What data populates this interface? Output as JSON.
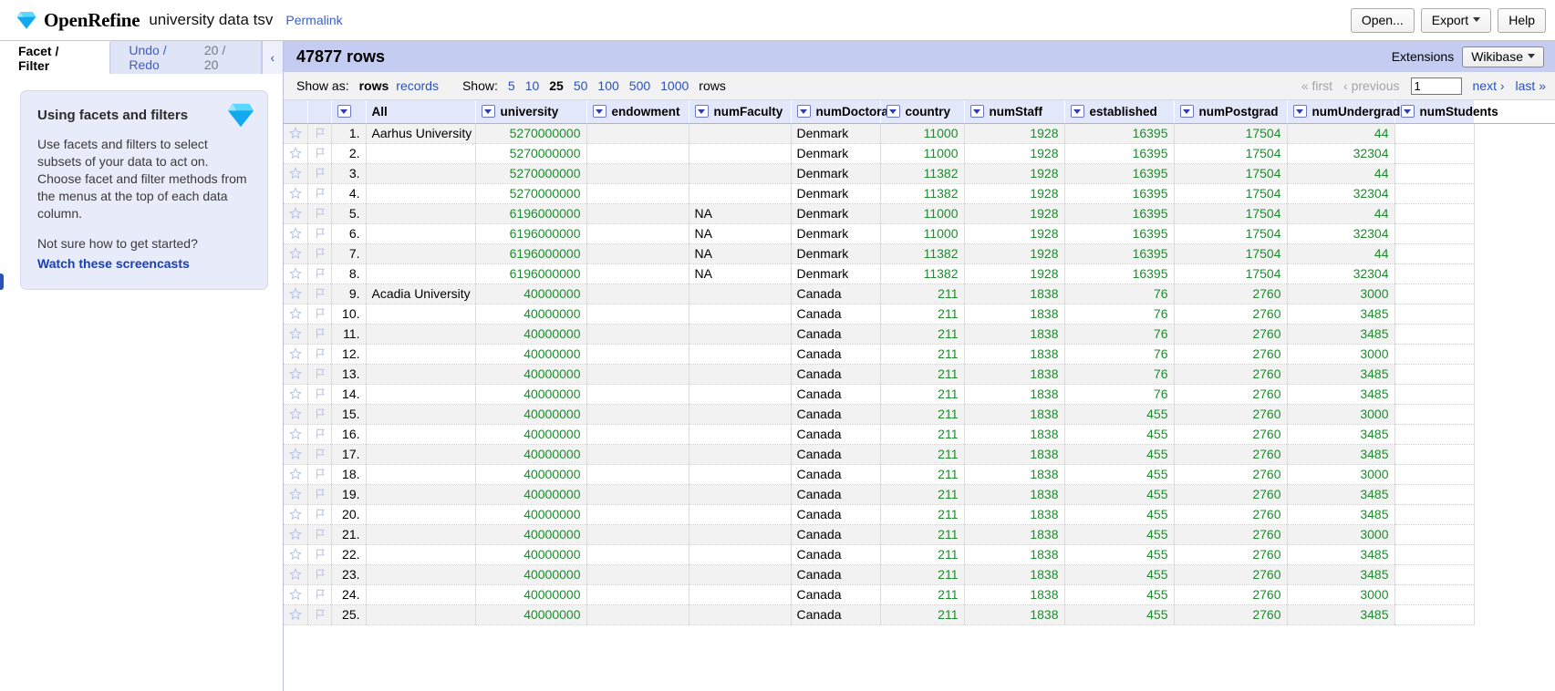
{
  "header": {
    "app_title": "OpenRefine",
    "project_name": "university data tsv",
    "permalink": "Permalink",
    "open_button": "Open...",
    "export_button": "Export",
    "help_button": "Help"
  },
  "left_panel": {
    "tabs": [
      {
        "label": "Facet / Filter",
        "active": true
      },
      {
        "label": "Undo / Redo",
        "count": "20 / 20",
        "active": false
      }
    ],
    "collapse_icon": "‹",
    "help_box": {
      "title": "Using facets and filters",
      "paragraph1": "Use facets and filters to select subsets of your data to act on. Choose facet and filter methods from the menus at the top of each data column.",
      "paragraph2": "Not sure how to get started?",
      "link": "Watch these screencasts"
    }
  },
  "summary_bar": {
    "row_count": "47877 rows",
    "extensions_label": "Extensions",
    "wikibase_button": "Wikibase"
  },
  "controls": {
    "show_as_label": "Show as:",
    "show_as_options": [
      {
        "label": "rows",
        "selected": true
      },
      {
        "label": "records",
        "selected": false
      }
    ],
    "show_label": "Show:",
    "page_sizes": [
      {
        "label": "5",
        "selected": false
      },
      {
        "label": "10",
        "selected": false
      },
      {
        "label": "25",
        "selected": true
      },
      {
        "label": "50",
        "selected": false
      },
      {
        "label": "100",
        "selected": false
      },
      {
        "label": "500",
        "selected": false
      },
      {
        "label": "1000",
        "selected": false
      }
    ],
    "rows_word": "rows",
    "pager": {
      "first": "« first",
      "previous": "‹ previous",
      "page_value": "1",
      "next": "next ›",
      "last": "last »"
    }
  },
  "table": {
    "columns": [
      "All",
      "university",
      "endowment",
      "numFaculty",
      "numDoctoral",
      "country",
      "numStaff",
      "established",
      "numPostgrad",
      "numUndergrad",
      "numStudents"
    ],
    "rows": [
      {
        "index": "1.",
        "university": "Aarhus University",
        "endowment": "5270000000",
        "numFaculty": "",
        "numDoctoral": "",
        "country": "Denmark",
        "numStaff": "11000",
        "established": "1928",
        "numPostgrad": "16395",
        "numUndergrad": "17504",
        "numStudents": "44"
      },
      {
        "index": "2.",
        "university": "",
        "endowment": "5270000000",
        "numFaculty": "",
        "numDoctoral": "",
        "country": "Denmark",
        "numStaff": "11000",
        "established": "1928",
        "numPostgrad": "16395",
        "numUndergrad": "17504",
        "numStudents": "32304"
      },
      {
        "index": "3.",
        "university": "",
        "endowment": "5270000000",
        "numFaculty": "",
        "numDoctoral": "",
        "country": "Denmark",
        "numStaff": "11382",
        "established": "1928",
        "numPostgrad": "16395",
        "numUndergrad": "17504",
        "numStudents": "44"
      },
      {
        "index": "4.",
        "university": "",
        "endowment": "5270000000",
        "numFaculty": "",
        "numDoctoral": "",
        "country": "Denmark",
        "numStaff": "11382",
        "established": "1928",
        "numPostgrad": "16395",
        "numUndergrad": "17504",
        "numStudents": "32304"
      },
      {
        "index": "5.",
        "university": "",
        "endowment": "6196000000",
        "numFaculty": "",
        "numDoctoral": "NA",
        "country": "Denmark",
        "numStaff": "11000",
        "established": "1928",
        "numPostgrad": "16395",
        "numUndergrad": "17504",
        "numStudents": "44"
      },
      {
        "index": "6.",
        "university": "",
        "endowment": "6196000000",
        "numFaculty": "",
        "numDoctoral": "NA",
        "country": "Denmark",
        "numStaff": "11000",
        "established": "1928",
        "numPostgrad": "16395",
        "numUndergrad": "17504",
        "numStudents": "32304"
      },
      {
        "index": "7.",
        "university": "",
        "endowment": "6196000000",
        "numFaculty": "",
        "numDoctoral": "NA",
        "country": "Denmark",
        "numStaff": "11382",
        "established": "1928",
        "numPostgrad": "16395",
        "numUndergrad": "17504",
        "numStudents": "44"
      },
      {
        "index": "8.",
        "university": "",
        "endowment": "6196000000",
        "numFaculty": "",
        "numDoctoral": "NA",
        "country": "Denmark",
        "numStaff": "11382",
        "established": "1928",
        "numPostgrad": "16395",
        "numUndergrad": "17504",
        "numStudents": "32304"
      },
      {
        "index": "9.",
        "university": "Acadia University",
        "endowment": "40000000",
        "numFaculty": "",
        "numDoctoral": "",
        "country": "Canada",
        "numStaff": "211",
        "established": "1838",
        "numPostgrad": "76",
        "numUndergrad": "2760",
        "numStudents": "3000"
      },
      {
        "index": "10.",
        "university": "",
        "endowment": "40000000",
        "numFaculty": "",
        "numDoctoral": "",
        "country": "Canada",
        "numStaff": "211",
        "established": "1838",
        "numPostgrad": "76",
        "numUndergrad": "2760",
        "numStudents": "3485"
      },
      {
        "index": "11.",
        "university": "",
        "endowment": "40000000",
        "numFaculty": "",
        "numDoctoral": "",
        "country": "Canada",
        "numStaff": "211",
        "established": "1838",
        "numPostgrad": "76",
        "numUndergrad": "2760",
        "numStudents": "3485"
      },
      {
        "index": "12.",
        "university": "",
        "endowment": "40000000",
        "numFaculty": "",
        "numDoctoral": "",
        "country": "Canada",
        "numStaff": "211",
        "established": "1838",
        "numPostgrad": "76",
        "numUndergrad": "2760",
        "numStudents": "3000"
      },
      {
        "index": "13.",
        "university": "",
        "endowment": "40000000",
        "numFaculty": "",
        "numDoctoral": "",
        "country": "Canada",
        "numStaff": "211",
        "established": "1838",
        "numPostgrad": "76",
        "numUndergrad": "2760",
        "numStudents": "3485"
      },
      {
        "index": "14.",
        "university": "",
        "endowment": "40000000",
        "numFaculty": "",
        "numDoctoral": "",
        "country": "Canada",
        "numStaff": "211",
        "established": "1838",
        "numPostgrad": "76",
        "numUndergrad": "2760",
        "numStudents": "3485"
      },
      {
        "index": "15.",
        "university": "",
        "endowment": "40000000",
        "numFaculty": "",
        "numDoctoral": "",
        "country": "Canada",
        "numStaff": "211",
        "established": "1838",
        "numPostgrad": "455",
        "numUndergrad": "2760",
        "numStudents": "3000"
      },
      {
        "index": "16.",
        "university": "",
        "endowment": "40000000",
        "numFaculty": "",
        "numDoctoral": "",
        "country": "Canada",
        "numStaff": "211",
        "established": "1838",
        "numPostgrad": "455",
        "numUndergrad": "2760",
        "numStudents": "3485"
      },
      {
        "index": "17.",
        "university": "",
        "endowment": "40000000",
        "numFaculty": "",
        "numDoctoral": "",
        "country": "Canada",
        "numStaff": "211",
        "established": "1838",
        "numPostgrad": "455",
        "numUndergrad": "2760",
        "numStudents": "3485"
      },
      {
        "index": "18.",
        "university": "",
        "endowment": "40000000",
        "numFaculty": "",
        "numDoctoral": "",
        "country": "Canada",
        "numStaff": "211",
        "established": "1838",
        "numPostgrad": "455",
        "numUndergrad": "2760",
        "numStudents": "3000"
      },
      {
        "index": "19.",
        "university": "",
        "endowment": "40000000",
        "numFaculty": "",
        "numDoctoral": "",
        "country": "Canada",
        "numStaff": "211",
        "established": "1838",
        "numPostgrad": "455",
        "numUndergrad": "2760",
        "numStudents": "3485"
      },
      {
        "index": "20.",
        "university": "",
        "endowment": "40000000",
        "numFaculty": "",
        "numDoctoral": "",
        "country": "Canada",
        "numStaff": "211",
        "established": "1838",
        "numPostgrad": "455",
        "numUndergrad": "2760",
        "numStudents": "3485"
      },
      {
        "index": "21.",
        "university": "",
        "endowment": "40000000",
        "numFaculty": "",
        "numDoctoral": "",
        "country": "Canada",
        "numStaff": "211",
        "established": "1838",
        "numPostgrad": "455",
        "numUndergrad": "2760",
        "numStudents": "3000"
      },
      {
        "index": "22.",
        "university": "",
        "endowment": "40000000",
        "numFaculty": "",
        "numDoctoral": "",
        "country": "Canada",
        "numStaff": "211",
        "established": "1838",
        "numPostgrad": "455",
        "numUndergrad": "2760",
        "numStudents": "3485"
      },
      {
        "index": "23.",
        "university": "",
        "endowment": "40000000",
        "numFaculty": "",
        "numDoctoral": "",
        "country": "Canada",
        "numStaff": "211",
        "established": "1838",
        "numPostgrad": "455",
        "numUndergrad": "2760",
        "numStudents": "3485"
      },
      {
        "index": "24.",
        "university": "",
        "endowment": "40000000",
        "numFaculty": "",
        "numDoctoral": "",
        "country": "Canada",
        "numStaff": "211",
        "established": "1838",
        "numPostgrad": "455",
        "numUndergrad": "2760",
        "numStudents": "3000"
      },
      {
        "index": "25.",
        "university": "",
        "endowment": "40000000",
        "numFaculty": "",
        "numDoctoral": "",
        "country": "Canada",
        "numStaff": "211",
        "established": "1838",
        "numPostgrad": "455",
        "numUndergrad": "2760",
        "numStudents": "3485"
      }
    ]
  },
  "colors": {
    "accent_blue": "#2b51bd",
    "header_blue": "#e3e7fa",
    "summary_blue": "#c5ccf2",
    "number_green": "#1f8a2f"
  }
}
